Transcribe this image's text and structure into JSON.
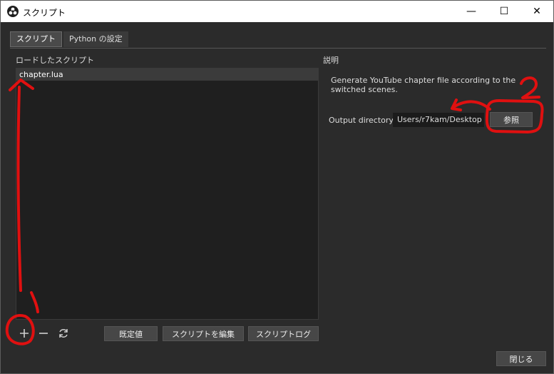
{
  "window": {
    "title": "スクリプト",
    "app_icon": "obs-icon",
    "controls": {
      "minimize": "—",
      "maximize": "☐",
      "close": "✕"
    }
  },
  "tabs": [
    {
      "label": "スクリプト",
      "active": true
    },
    {
      "label": "Python の設定",
      "active": false
    }
  ],
  "loaded_scripts": {
    "header": "ロードしたスクリプト",
    "items": [
      "chapter.lua"
    ]
  },
  "script_buttons": {
    "add_icon": "plus-icon",
    "remove_icon": "minus-icon",
    "reload_icon": "reload-icon",
    "defaults_label": "既定値",
    "edit_label": "スクリプトを編集",
    "log_label": "スクリプトログ"
  },
  "description": {
    "header": "説明",
    "text": "Generate YouTube chapter file according to the switched scenes."
  },
  "settings": {
    "output_directory_label": "Output directory",
    "output_directory_value": "Users/r7kam/Desktop",
    "browse_label": "参照"
  },
  "footer": {
    "close_label": "閉じる"
  },
  "annotations": {
    "color": "#e01010",
    "marks": [
      "1",
      "2"
    ]
  }
}
